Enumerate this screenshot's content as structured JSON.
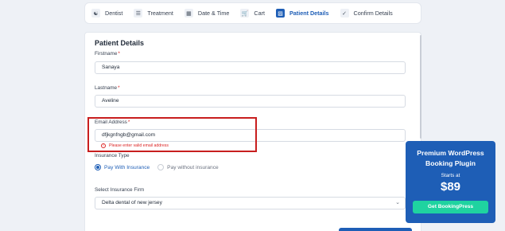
{
  "steps": [
    {
      "label": "Dentist",
      "icon": "people-icon"
    },
    {
      "label": "Treatment",
      "icon": "list-icon"
    },
    {
      "label": "Date & Time",
      "icon": "calendar-icon"
    },
    {
      "label": "Cart",
      "icon": "cart-icon"
    },
    {
      "label": "Patient Details",
      "icon": "person-card-icon",
      "active": true
    },
    {
      "label": "Confirm Details",
      "icon": "checkbox-icon"
    }
  ],
  "form": {
    "title": "Patient Details",
    "firstname": {
      "label": "Firstname",
      "required": "*",
      "value": "Sanaya"
    },
    "lastname": {
      "label": "Lastname",
      "required": "*",
      "value": "Aveline"
    },
    "email": {
      "label": "Email Address",
      "required": "*",
      "value": "dfjkgnfngb@gmail.com",
      "error": "Please enter valid email address"
    },
    "insurance_type": {
      "label": "Insurance Type",
      "options": [
        "Pay With Insurance",
        "Pay without insurance"
      ],
      "selected": "Pay With Insurance"
    },
    "insurance_firm": {
      "label": "Select Insurance Firm",
      "value": "Delta dental of new jersey"
    }
  },
  "promo": {
    "title": "Premium WordPress Booking Plugin",
    "starts_at": "Starts at",
    "price": "$89",
    "button": "Get BookingPress"
  },
  "colors": {
    "accent": "#1e5eb6",
    "error": "#c81e1e",
    "promo_button": "#1fd3a0"
  }
}
